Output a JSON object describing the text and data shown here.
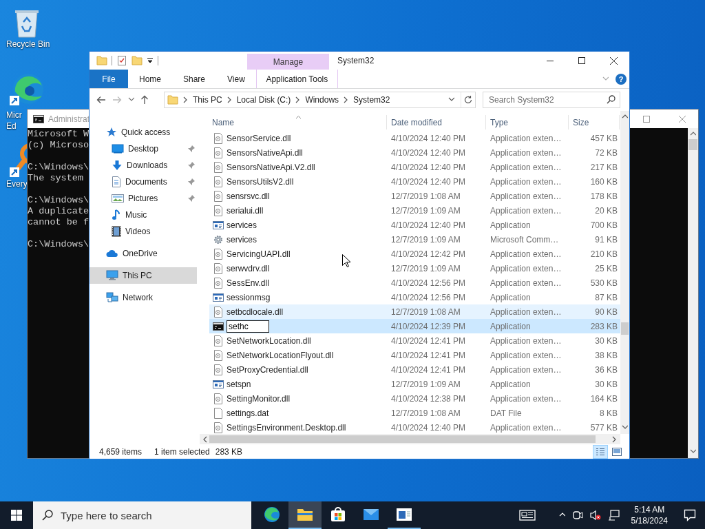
{
  "desktop_icons": [
    {
      "kind": "recycle",
      "lines": [
        "Recycle Bin"
      ]
    },
    {
      "kind": "edge",
      "lines": [
        "Micr",
        "Ed"
      ]
    },
    {
      "kind": "everything",
      "lines": [
        "Every"
      ]
    }
  ],
  "console_window": {
    "title": "Administrat",
    "blocks": [
      [
        "Microsoft W",
        "(c) Microso"
      ],
      [
        "C:\\Windows\\",
        "The system"
      ],
      [
        "C:\\Windows\\",
        "A duplicate",
        "cannot be f"
      ],
      [
        "C:\\Windows\\"
      ]
    ]
  },
  "explorer_window": {
    "contextual_group": "Manage",
    "title": "System32",
    "ribbon_tabs": [
      {
        "label": "File",
        "kind": "file"
      },
      {
        "label": "Home",
        "kind": "normal"
      },
      {
        "label": "Share",
        "kind": "normal"
      },
      {
        "label": "View",
        "kind": "normal"
      },
      {
        "label": "Application Tools",
        "kind": "contextual"
      }
    ],
    "help": "?",
    "breadcrumbs": [
      "This PC",
      "Local Disk (C:)",
      "Windows",
      "System32"
    ],
    "search": {
      "placeholder": "Search System32"
    },
    "navigation": [
      {
        "label": "Quick access",
        "kind": "star",
        "selected": false,
        "children": [
          {
            "label": "Desktop",
            "kind": "desktop",
            "pinned": true,
            "selected": false
          },
          {
            "label": "Downloads",
            "kind": "downloads",
            "pinned": true,
            "selected": false
          },
          {
            "label": "Documents",
            "kind": "documents",
            "pinned": true,
            "selected": false
          },
          {
            "label": "Pictures",
            "kind": "pictures",
            "pinned": true,
            "selected": false
          },
          {
            "label": "Music",
            "kind": "music",
            "pinned": false,
            "selected": false
          },
          {
            "label": "Videos",
            "kind": "videos",
            "pinned": false,
            "selected": false
          }
        ]
      },
      {
        "label": "OneDrive",
        "kind": "cloud",
        "selected": false
      },
      {
        "label": "This PC",
        "kind": "pc",
        "selected": true
      },
      {
        "label": "Network",
        "kind": "network",
        "selected": false
      }
    ],
    "columns": [
      {
        "label": "Name",
        "sorted": true
      },
      {
        "label": "Date modified",
        "sorted": false
      },
      {
        "label": "Type",
        "sorted": false
      },
      {
        "label": "Size",
        "sorted": false
      }
    ],
    "rows": [
      {
        "name": "SensorService.dll",
        "date": "4/10/2024 12:40 PM",
        "type": "Application exten…",
        "size": "457 KB",
        "kind": "dll",
        "selected": false,
        "hovered": false,
        "renaming": false
      },
      {
        "name": "SensorsNativeApi.dll",
        "date": "4/10/2024 12:40 PM",
        "type": "Application exten…",
        "size": "72 KB",
        "kind": "dll",
        "selected": false,
        "hovered": false,
        "renaming": false
      },
      {
        "name": "SensorsNativeApi.V2.dll",
        "date": "4/10/2024 12:40 PM",
        "type": "Application exten…",
        "size": "217 KB",
        "kind": "dll",
        "selected": false,
        "hovered": false,
        "renaming": false
      },
      {
        "name": "SensorsUtilsV2.dll",
        "date": "4/10/2024 12:40 PM",
        "type": "Application exten…",
        "size": "160 KB",
        "kind": "dll",
        "selected": false,
        "hovered": false,
        "renaming": false
      },
      {
        "name": "sensrsvc.dll",
        "date": "12/7/2019 1:08 AM",
        "type": "Application exten…",
        "size": "178 KB",
        "kind": "dll",
        "selected": false,
        "hovered": false,
        "renaming": false
      },
      {
        "name": "serialui.dll",
        "date": "12/7/2019 1:09 AM",
        "type": "Application exten…",
        "size": "20 KB",
        "kind": "dll",
        "selected": false,
        "hovered": false,
        "renaming": false
      },
      {
        "name": "services",
        "date": "4/10/2024 12:40 PM",
        "type": "Application",
        "size": "700 KB",
        "kind": "app",
        "selected": false,
        "hovered": false,
        "renaming": false
      },
      {
        "name": "services",
        "date": "12/7/2019 1:09 AM",
        "type": "Microsoft Comm…",
        "size": "91 KB",
        "kind": "gear",
        "selected": false,
        "hovered": false,
        "renaming": false
      },
      {
        "name": "ServicingUAPI.dll",
        "date": "4/10/2024 12:42 PM",
        "type": "Application exten…",
        "size": "210 KB",
        "kind": "dll",
        "selected": false,
        "hovered": false,
        "renaming": false
      },
      {
        "name": "serwvdrv.dll",
        "date": "12/7/2019 1:09 AM",
        "type": "Application exten…",
        "size": "25 KB",
        "kind": "dll",
        "selected": false,
        "hovered": false,
        "renaming": false
      },
      {
        "name": "SessEnv.dll",
        "date": "4/10/2024 12:56 PM",
        "type": "Application exten…",
        "size": "530 KB",
        "kind": "dll",
        "selected": false,
        "hovered": false,
        "renaming": false
      },
      {
        "name": "sessionmsg",
        "date": "4/10/2024 12:56 PM",
        "type": "Application",
        "size": "87 KB",
        "kind": "app",
        "selected": false,
        "hovered": false,
        "renaming": false
      },
      {
        "name": "setbcdlocale.dll",
        "date": "12/7/2019 1:08 AM",
        "type": "Application exten…",
        "size": "90 KB",
        "kind": "dll",
        "selected": false,
        "hovered": true,
        "renaming": false
      },
      {
        "name": "sethc",
        "date": "4/10/2024 12:39 PM",
        "type": "Application",
        "size": "283 KB",
        "kind": "console",
        "selected": true,
        "hovered": false,
        "renaming": true
      },
      {
        "name": "SetNetworkLocation.dll",
        "date": "4/10/2024 12:41 PM",
        "type": "Application exten…",
        "size": "30 KB",
        "kind": "dll",
        "selected": false,
        "hovered": false,
        "renaming": false
      },
      {
        "name": "SetNetworkLocationFlyout.dll",
        "date": "4/10/2024 12:41 PM",
        "type": "Application exten…",
        "size": "38 KB",
        "kind": "dll",
        "selected": false,
        "hovered": false,
        "renaming": false
      },
      {
        "name": "SetProxyCredential.dll",
        "date": "4/10/2024 12:41 PM",
        "type": "Application exten…",
        "size": "36 KB",
        "kind": "dll",
        "selected": false,
        "hovered": false,
        "renaming": false
      },
      {
        "name": "setspn",
        "date": "12/7/2019 1:09 AM",
        "type": "Application",
        "size": "30 KB",
        "kind": "app",
        "selected": false,
        "hovered": false,
        "renaming": false
      },
      {
        "name": "SettingMonitor.dll",
        "date": "4/10/2024 12:38 PM",
        "type": "Application exten…",
        "size": "164 KB",
        "kind": "dll",
        "selected": false,
        "hovered": false,
        "renaming": false
      },
      {
        "name": "settings.dat",
        "date": "12/7/2019 1:08 AM",
        "type": "DAT File",
        "size": "8 KB",
        "kind": "file",
        "selected": false,
        "hovered": false,
        "renaming": false
      },
      {
        "name": "SettingsEnvironment.Desktop.dll",
        "date": "4/10/2024 12:40 PM",
        "type": "Application exten…",
        "size": "577 KB",
        "kind": "dll",
        "selected": false,
        "hovered": false,
        "renaming": false
      }
    ],
    "status_bar": {
      "items": "4,659 items",
      "selection": "1 item selected",
      "selection_size": "283 KB"
    },
    "views": [
      {
        "kind": "details",
        "selected": true
      },
      {
        "kind": "large",
        "selected": false
      }
    ]
  },
  "taskbar": {
    "search": {
      "placeholder": "Type here to search"
    },
    "apps": [
      {
        "kind": "edge",
        "active": false,
        "running": false
      },
      {
        "kind": "explorer",
        "active": true,
        "running": true
      },
      {
        "kind": "store",
        "active": false,
        "running": false
      },
      {
        "kind": "mail",
        "active": false,
        "running": false
      },
      {
        "kind": "window",
        "active": false,
        "running": true
      }
    ],
    "clock": {
      "time": "5:14 AM",
      "date": "5/18/2024"
    }
  }
}
